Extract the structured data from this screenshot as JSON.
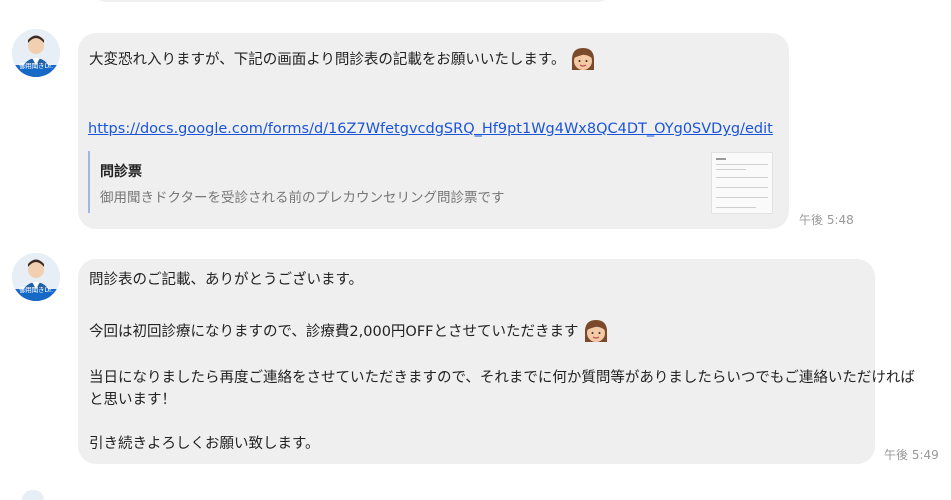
{
  "sender": {
    "avatar_label": "御用聞きDr."
  },
  "messages": [
    {
      "lines": [
        "大変恐れ入りますが、下記の画面より問診表の記載をお願いいたします。"
      ],
      "link": "https://docs.google.com/forms/d/16Z7WfetgvcdgSRQ_Hf9pt1Wg4Wx8QC4DT_OYg0SVDyg/edit",
      "preview": {
        "title": "問診票",
        "description": "御用聞きドクターを受診される前のプレカウンセリング問診票です"
      },
      "time": "午後 5:48"
    },
    {
      "lines": [
        "問診表のご記載、ありがとうございます。",
        "今回は初回診療になりますので、診療費2,000円OFFとさせていただきます",
        "当日になりましたら再度ご連絡をさせていただきますので、それまでに何か質問等がありましたらいつでもご連絡いただければ",
        "と思います！",
        "引き続きよろしくお願い致します。"
      ],
      "time": "午後 5:49"
    }
  ],
  "colors": {
    "bubble": "#efefef",
    "link": "#1a55d9",
    "timestamp": "#999999",
    "preview_bar": "#9db7e8"
  },
  "icons": [
    "avatar-photo",
    "woman-face-emoji"
  ]
}
